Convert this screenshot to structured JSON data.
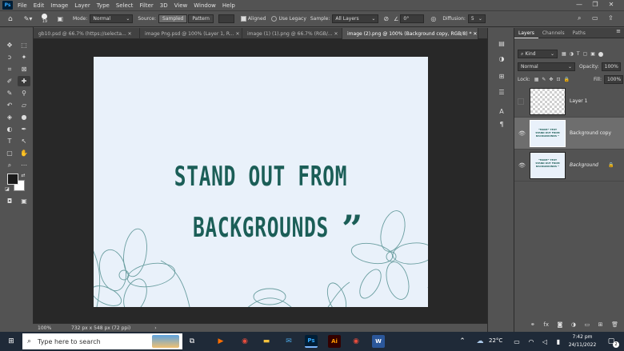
{
  "app": {
    "logo": "Ps"
  },
  "menu": [
    "File",
    "Edit",
    "Image",
    "Layer",
    "Type",
    "Select",
    "Filter",
    "3D",
    "View",
    "Window",
    "Help"
  ],
  "window_controls": {
    "minimize": "—",
    "restore": "❐",
    "close": "✕"
  },
  "options": {
    "brush_size": "19",
    "mode_label": "Mode:",
    "mode_value": "Normal",
    "source_label": "Source:",
    "source_sampled": "Sampled",
    "source_pattern": "Pattern",
    "aligned_label": "Aligned",
    "use_legacy_label": "Use Legacy",
    "sample_label": "Sample:",
    "sample_value": "All Layers",
    "angle_value": "0°",
    "diffusion_label": "Diffusion:",
    "diffusion_value": "5"
  },
  "tabs": [
    {
      "label": "gb10.psd @ 66.7% (https://selecta... ✕"
    },
    {
      "label": "image Png.psd @ 100% (Layer 1, R... ✕"
    },
    {
      "label": "image (1) (1).png @ 66.7% (RGB/... ✕"
    },
    {
      "label": "image (2).png @ 100% (Background copy, RGB/8) * ✕"
    }
  ],
  "canvas": {
    "line1": "STAND OUT FROM",
    "line2": "BACKGROUNDS",
    "quote": "”",
    "text_color": "#1b5e57",
    "bg_color": "#e9f1fa"
  },
  "status": {
    "zoom": "100%",
    "doc_size": "732 px x 548 px (72 ppi)",
    "arrow": "›"
  },
  "panel": {
    "tabs": [
      "Layers",
      "Channels",
      "Paths"
    ],
    "kind_label": "Kind",
    "blend_mode": "Normal",
    "opacity_label": "Opacity:",
    "opacity_value": "100%",
    "lock_label": "Lock:",
    "fill_label": "Fill:",
    "fill_value": "100%",
    "layers": [
      {
        "name": "Layer 1"
      },
      {
        "name": "Background copy"
      },
      {
        "name": "Background"
      }
    ],
    "thumb_text": "“MAKE” TEXT STAND OUT FROM BACKGROUNDS ”"
  },
  "taskbar": {
    "search_placeholder": "Type here to search",
    "temperature": "22°C",
    "time": "7:42 pm",
    "date": "24/11/2022",
    "notif_count": "2"
  }
}
